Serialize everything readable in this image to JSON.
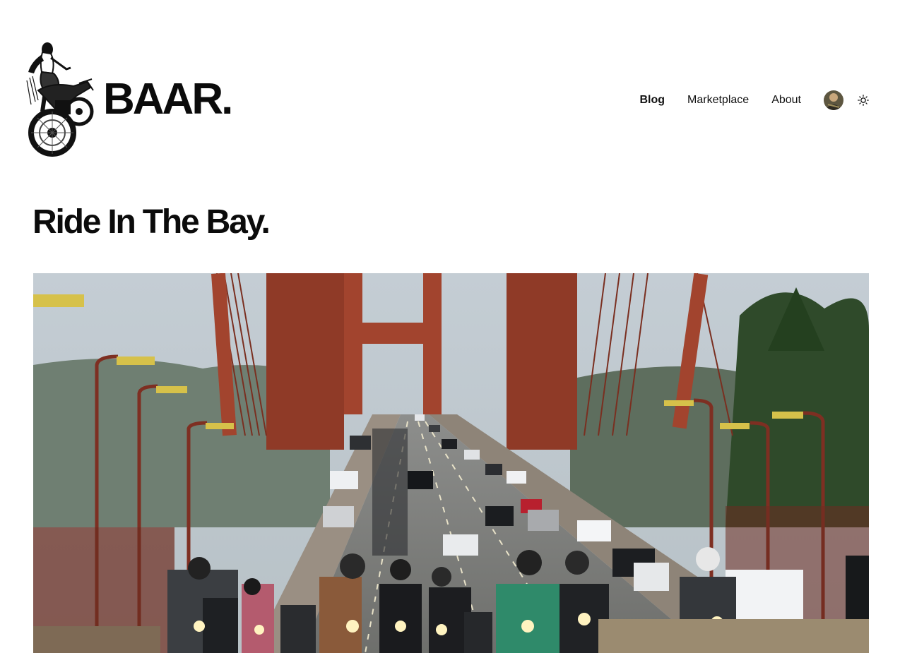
{
  "site": {
    "title": "BAAR.",
    "logo_icon": "motorcycle-rider-illustration"
  },
  "nav": {
    "items": [
      {
        "label": "Blog",
        "active": true
      },
      {
        "label": "Marketplace",
        "active": false
      },
      {
        "label": "About",
        "active": false
      }
    ],
    "avatar_icon": "user-avatar",
    "theme_toggle_icon": "sun-icon"
  },
  "post": {
    "title": "Ride In The Bay.",
    "hero_image": "motorcycle-riders-on-golden-gate-bridge"
  },
  "colors": {
    "text": "#0b0b0b",
    "background": "#ffffff",
    "bridge": "#a2442e"
  }
}
